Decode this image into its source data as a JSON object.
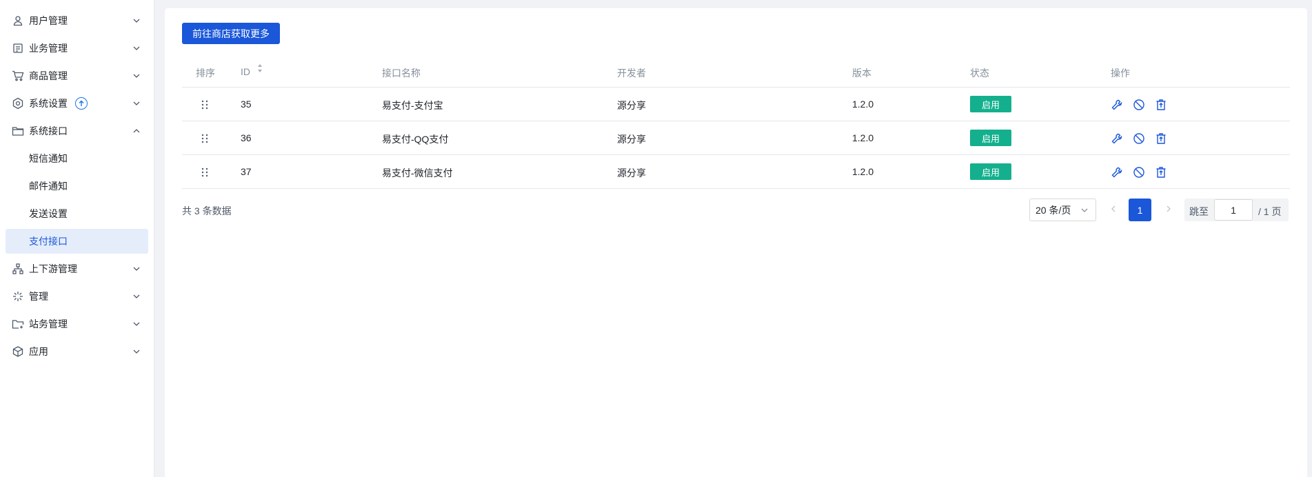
{
  "sidebar": {
    "items": [
      {
        "label": "用户管理",
        "icon": "user-icon",
        "expanded": false
      },
      {
        "label": "业务管理",
        "icon": "document-icon",
        "expanded": false
      },
      {
        "label": "商品管理",
        "icon": "cart-icon",
        "expanded": false
      },
      {
        "label": "系统设置",
        "icon": "settings-icon",
        "expanded": false,
        "badge": "update-icon"
      },
      {
        "label": "系统接口",
        "icon": "folder-icon",
        "expanded": true
      },
      {
        "label": "上下游管理",
        "icon": "hierarchy-icon",
        "expanded": false
      },
      {
        "label": "管理",
        "icon": "sparkle-icon",
        "expanded": false
      },
      {
        "label": "站务管理",
        "icon": "folder-plus-icon",
        "expanded": false
      },
      {
        "label": "应用",
        "icon": "box-icon",
        "expanded": false
      }
    ],
    "subitems": [
      {
        "label": "短信通知",
        "active": false
      },
      {
        "label": "邮件通知",
        "active": false
      },
      {
        "label": "发送设置",
        "active": false
      },
      {
        "label": "支付接口",
        "active": true
      }
    ]
  },
  "main": {
    "store_button": "前往商店获取更多",
    "table": {
      "headers": {
        "sort": "排序",
        "id": "ID",
        "name": "接口名称",
        "developer": "开发者",
        "version": "版本",
        "status": "状态",
        "actions": "操作"
      },
      "rows": [
        {
          "id": "35",
          "name": "易支付-支付宝",
          "developer": "源分享",
          "version": "1.2.0",
          "status": "启用"
        },
        {
          "id": "36",
          "name": "易支付-QQ支付",
          "developer": "源分享",
          "version": "1.2.0",
          "status": "启用"
        },
        {
          "id": "37",
          "name": "易支付-微信支付",
          "developer": "源分享",
          "version": "1.2.0",
          "status": "启用"
        }
      ]
    },
    "pagination": {
      "total": "共 3 条数据",
      "page_size": "20 条/页",
      "current_page": "1",
      "jump_label": "跳至",
      "jump_value": "1",
      "page_total": "/ 1 页"
    }
  },
  "colors": {
    "primary": "#1a57d9",
    "status_enabled": "#14b08e",
    "active_menu_bg": "#e5edfb"
  }
}
